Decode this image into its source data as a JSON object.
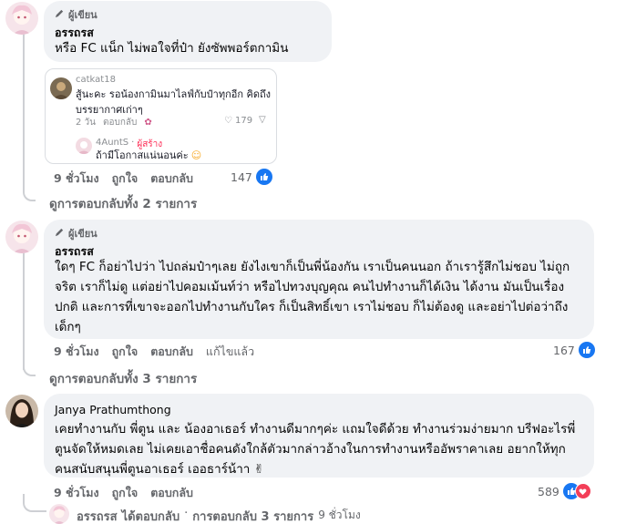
{
  "comments": [
    {
      "author_badge": "ผู้เขียน",
      "author": "อรรถรส",
      "lines": [
        "หรือ FC แน็ก ไม่พอใจที่ป๋า ยังซัพพอร์ตกามิน"
      ],
      "time": "9 ชั่วโมง",
      "like": "ถูกใจ",
      "reply": "ตอบกลับ",
      "count": "147",
      "view_replies": "ดูการตอบกลับทั้ง 2 รายการ",
      "embed": {
        "user": "catkat18",
        "text_lines": [
          "สู้นะคะ รอน้องกามินมาไลฟ์กับป๋าทุกอีก คิดถึง",
          "บรรยากาศเก่าๆ"
        ],
        "date": "2 วัน",
        "reply": "ตอบกลับ",
        "likes": "179",
        "reply_user": "4AuntS",
        "reply_badge": "ผู้สร้าง",
        "reply_text": "ถ้ามีโอกาสแน่นอนค่ะ"
      }
    },
    {
      "author_badge": "ผู้เขียน",
      "author": "อรรถรส",
      "lines": [
        "ใดๆ FC ก็อย่าไปว่า ไปถล่มป๋าๆเลย ยังไงเขาก็เป็นพี่น้องกัน เราเป็นคนนอก ถ้าเรารู้สึกไม่ชอบ ไม่ถูก",
        "จริต เราก็ไม่ดู แต่อย่าไปคอมเม้นท์ว่า หรือไปทวงบุญคุณ คนไปทำงานก็ได้เงิน ได้งาน มันเป็นเรื่อง",
        "ปกติ และการที่เขาจะออกไปทำงานกับใคร ก็เป็นสิทธิ์เขา เราไม่ชอบ ก็ไม่ต้องดู และอย่าไปต่อว่าถึง",
        "เด็กๆ"
      ],
      "time": "9 ชั่วโมง",
      "like": "ถูกใจ",
      "reply": "ตอบกลับ",
      "edited": "แก้ไขแล้ว",
      "count": "167",
      "view_replies": "ดูการตอบกลับทั้ง 3 รายการ"
    },
    {
      "author": "Janya Prathumthong",
      "lines": [
        "เคยทำงานกับ พี่ตูน และ น้องอาเธอร์ ทำงานดีมากๆค่ะ แถมใจดีด้วย ทำงานร่วมง่ายมาก บรีฟอะไรพี่",
        "ตูนจัดให้หมดเลย ไม่เคยเอาชื่อคนดังใกล้ตัวมากล่าวอ้างในการทำงานหรืออัพราคาเลย อยากให้ทุก",
        "คนสนับสนุนพี่ตูนอาเธอร์ เออธาร์น้าา ✌"
      ],
      "time": "9 ชั่วโมง",
      "like": "ถูกใจ",
      "reply": "ตอบกลับ",
      "count": "589",
      "reply_summary": {
        "name": "อรรถรส",
        "action": "ได้ตอบกลับ",
        "separator": "·",
        "replies": "การตอบกลับ 3 รายการ",
        "time": "9 ชั่วโมง"
      }
    }
  ],
  "colors": {
    "bubble": "#f0f2f5",
    "like_blue": "#1877f2",
    "love_red": "#f33e58",
    "secondary_text": "#65676b"
  }
}
